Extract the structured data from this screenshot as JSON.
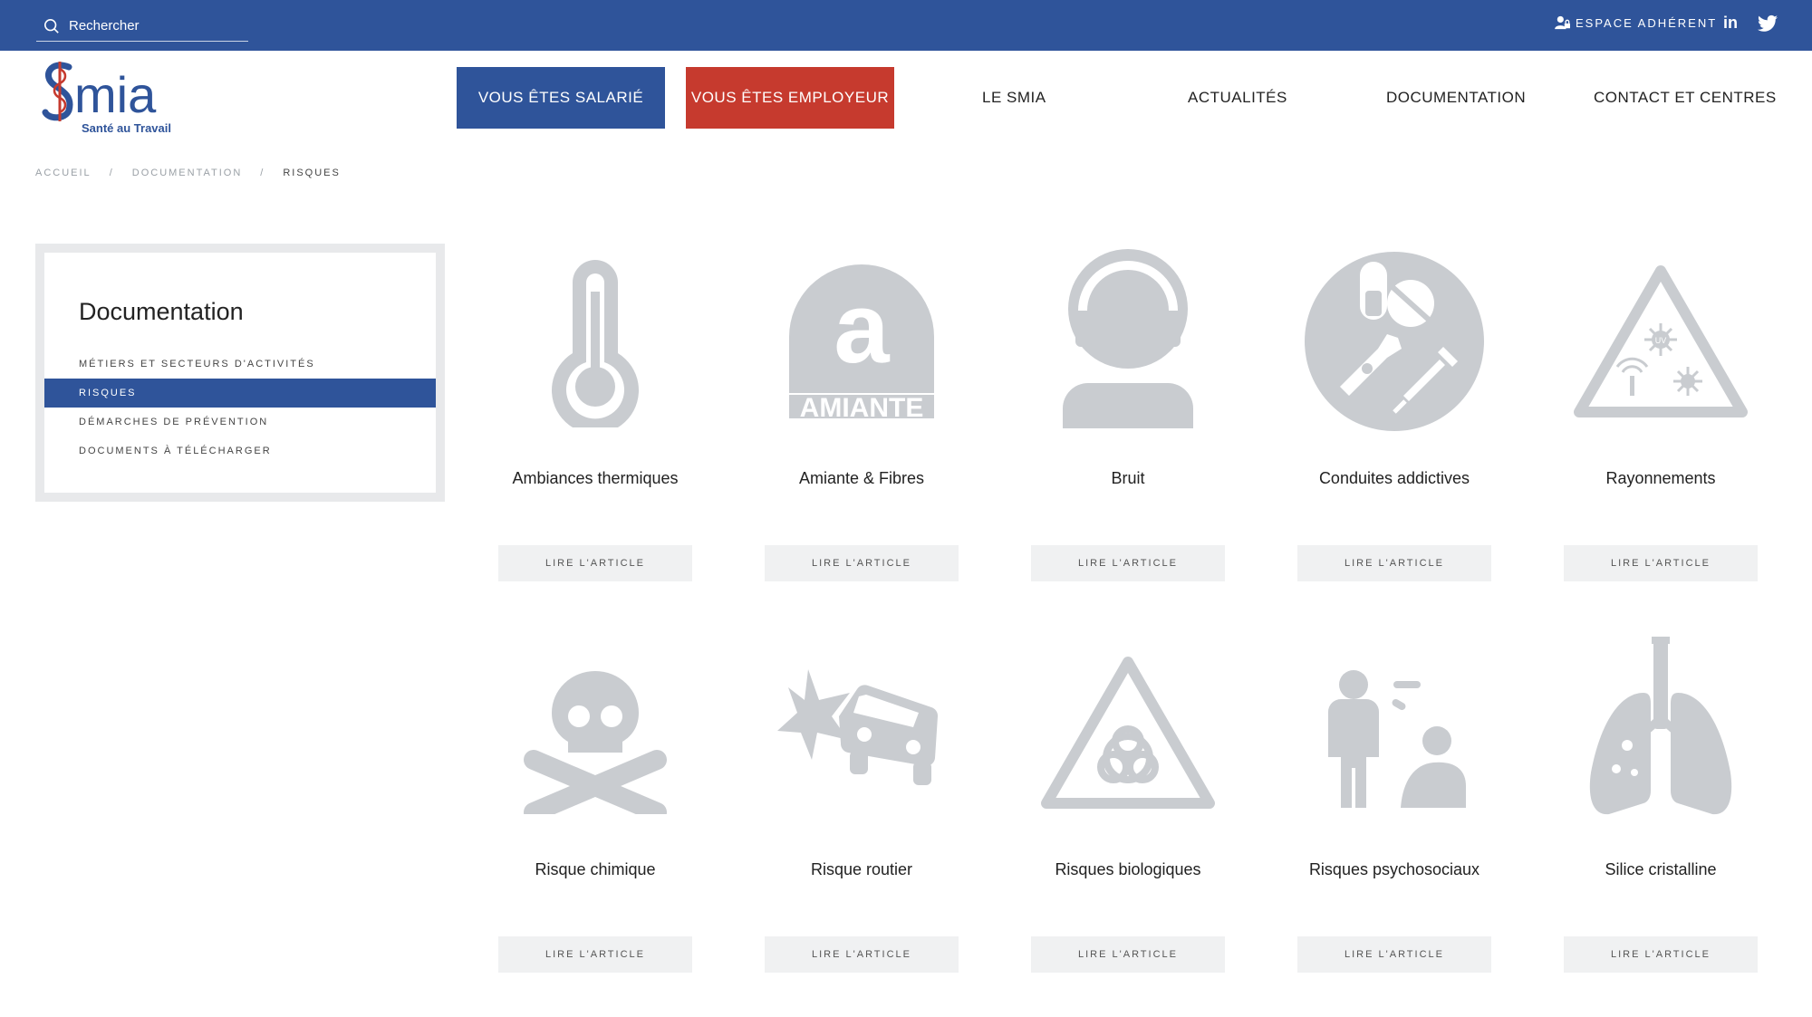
{
  "topbar": {
    "search_placeholder": "Rechercher",
    "espace_label": "ESPACE ADHÉRENT",
    "linkedin_label": "in"
  },
  "logo": {
    "text": "Smia",
    "subtitle": "Santé au Travail"
  },
  "nav": {
    "salarie": "VOUS ÊTES SALARIÉ",
    "employeur": "VOUS ÊTES EMPLOYEUR",
    "le_smia": "LE SMIA",
    "actualites": "ACTUALITÉS",
    "documentation": "DOCUMENTATION",
    "contact": "CONTACT ET CENTRES"
  },
  "breadcrumb": {
    "items": [
      "ACCUEIL",
      "DOCUMENTATION",
      "RISQUES"
    ],
    "separator": "/"
  },
  "sidebar": {
    "title": "Documentation",
    "items": [
      {
        "label": "MÉTIERS ET SECTEURS D'ACTIVITÉS"
      },
      {
        "label": "RISQUES",
        "active": true
      },
      {
        "label": "DÉMARCHES DE PRÉVENTION"
      },
      {
        "label": "DOCUMENTS À TÉLÉCHARGER"
      }
    ]
  },
  "cards": [
    {
      "title": "Ambiances thermiques",
      "icon": "thermometer-icon",
      "button": "LIRE L'ARTICLE"
    },
    {
      "title": "Amiante & Fibres",
      "icon": "amiante-icon",
      "icon_text": "AMIANTE",
      "icon_letter": "a",
      "button": "LIRE L'ARTICLE"
    },
    {
      "title": "Bruit",
      "icon": "headphones-icon",
      "button": "LIRE L'ARTICLE"
    },
    {
      "title": "Conduites addictives",
      "icon": "addiction-icon",
      "button": "LIRE L'ARTICLE"
    },
    {
      "title": "Rayonnements",
      "icon": "radiation-warning-icon",
      "icon_text": "UV",
      "button": "LIRE L'ARTICLE"
    },
    {
      "title": "Risque chimique",
      "icon": "skull-crossbones-icon",
      "button": "LIRE L'ARTICLE"
    },
    {
      "title": "Risque routier",
      "icon": "car-crash-icon",
      "button": "LIRE L'ARTICLE"
    },
    {
      "title": "Risques biologiques",
      "icon": "biohazard-icon",
      "button": "LIRE L'ARTICLE"
    },
    {
      "title": "Risques psychosociaux",
      "icon": "psychosocial-icon",
      "button": "LIRE L'ARTICLE"
    },
    {
      "title": "Silice cristalline",
      "icon": "lungs-icon",
      "button": "LIRE L'ARTICLE"
    }
  ],
  "colors": {
    "brand_blue": "#2f549a",
    "brand_red": "#c63a2e",
    "icon_grey": "#c9ccd0"
  }
}
